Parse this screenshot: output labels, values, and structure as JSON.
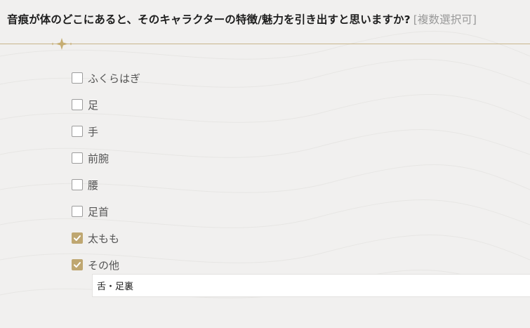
{
  "question": {
    "text": "音痕が体のどこにあると、そのキャラクターの特徴/魅力を引き出すと思いますか?",
    "note": "[複数選択可]"
  },
  "options": [
    {
      "label": "ふくらはぎ",
      "checked": false
    },
    {
      "label": "足",
      "checked": false
    },
    {
      "label": "手",
      "checked": false
    },
    {
      "label": "前腕",
      "checked": false
    },
    {
      "label": "腰",
      "checked": false
    },
    {
      "label": "足首",
      "checked": false
    },
    {
      "label": "太もも",
      "checked": true
    },
    {
      "label": "その他",
      "checked": true
    }
  ],
  "other_input": {
    "value": "舌・足裏"
  },
  "colors": {
    "accent": "#bfa771",
    "divider": "#c9b68c",
    "background": "#f1f0ef"
  }
}
